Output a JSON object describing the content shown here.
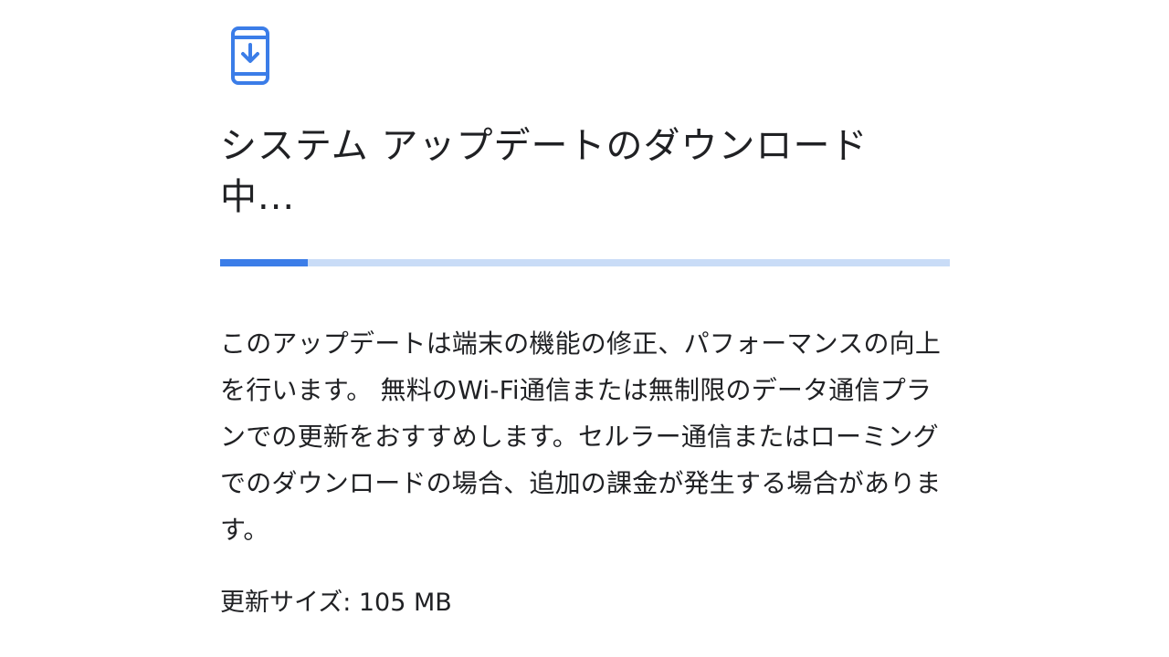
{
  "icon": {
    "name": "system-update-download-icon",
    "color": "#3b7de8"
  },
  "title": "システム アップデートのダウンロード中...",
  "progress": {
    "value": 0.12,
    "fill_color": "#3b7de8",
    "track_color": "#c9dcf7"
  },
  "description": "このアップデートは端末の機能の修正、パフォーマンスの向上を行います。 無料のWi-Fi通信または無制限のデータ通信プランでの更新をおすすめします。セルラー通信またはローミングでのダウンロードの場合、追加の課金が発生する場合があります。",
  "update_size": "更新サイズ: 105 MB"
}
